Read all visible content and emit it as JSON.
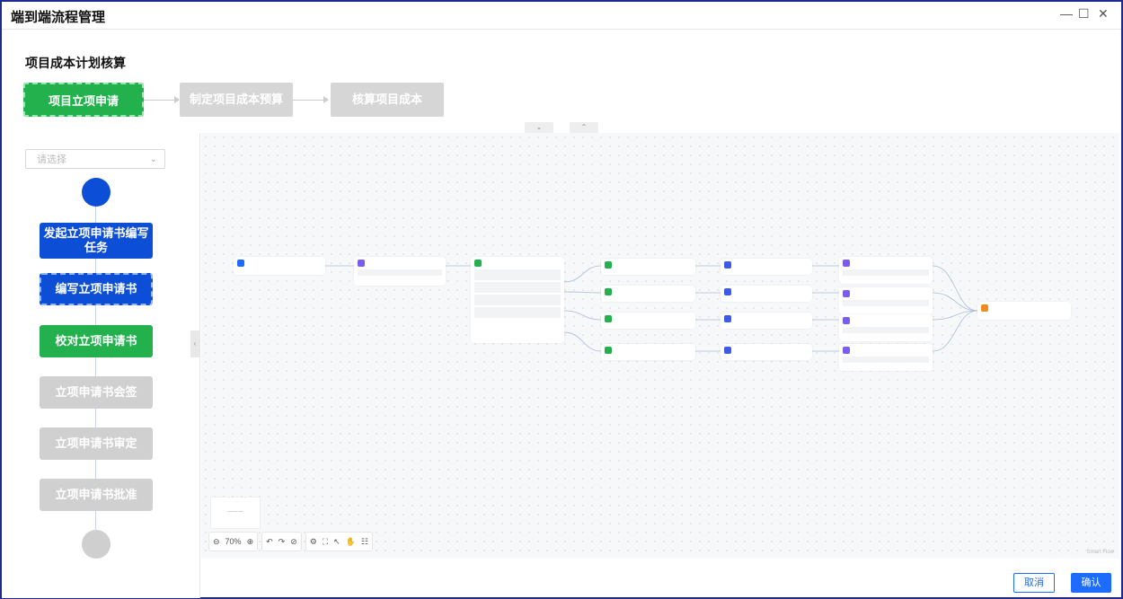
{
  "window": {
    "title": "端到端流程管理",
    "controls": [
      "—",
      "☐",
      "✕"
    ]
  },
  "page_title": "项目成本计划核算",
  "stages": [
    {
      "label": "项目立项申请",
      "state": "active"
    },
    {
      "label": "制定项目成本预算",
      "state": "inactive"
    },
    {
      "label": "核算项目成本",
      "state": "inactive"
    }
  ],
  "left_panel": {
    "select_placeholder": "请选择",
    "flow_nodes": [
      {
        "label": "发起立项申请书编写任务",
        "color": "blue"
      },
      {
        "label": "编写立项申请书",
        "color": "blue",
        "selected": true
      },
      {
        "label": "校对立项申请书",
        "color": "green"
      },
      {
        "label": "立项申请书会签",
        "color": "gray"
      },
      {
        "label": "立项申请书审定",
        "color": "gray"
      },
      {
        "label": "立项申请书批准",
        "color": "gray"
      }
    ]
  },
  "canvas": {
    "zoom": "70%",
    "minimap_label": "一一一",
    "watermark": "Smart Flow"
  },
  "footer": {
    "cancel_label": "取消",
    "ok_label": "确认"
  },
  "colors": {
    "active_green": "#22b14c",
    "flow_blue": "#0c4fd6",
    "inactive_gray": "#d0d0d0",
    "primary": "#1e6cff"
  }
}
